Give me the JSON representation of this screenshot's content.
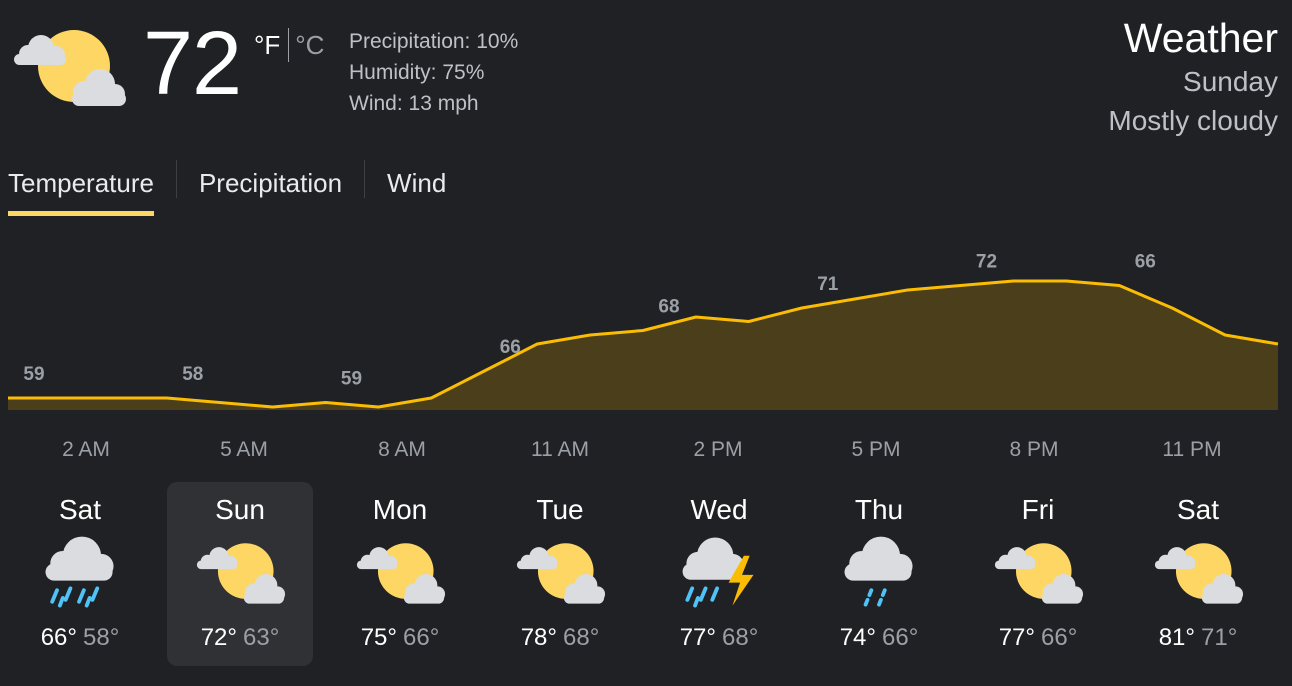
{
  "current": {
    "temperature": "72",
    "unit_f": "°F",
    "unit_c": "°C",
    "precipitation": "Precipitation: 10%",
    "humidity": "Humidity: 75%",
    "wind": "Wind: 13 mph",
    "icon": "partly-cloudy-icon"
  },
  "header": {
    "title": "Weather",
    "day": "Sunday",
    "condition": "Mostly cloudy"
  },
  "tabs": [
    {
      "label": "Temperature",
      "active": true
    },
    {
      "label": "Precipitation",
      "active": false
    },
    {
      "label": "Wind",
      "active": false
    }
  ],
  "colors": {
    "accent": "#fdd663",
    "chart_line": "#fbbc04",
    "chart_fill": "#4a3f1a",
    "background": "#202124",
    "selected_day": "#303134",
    "rain": "#4fc3f7"
  },
  "chart_data": {
    "type": "area",
    "x": [
      "12 AM",
      "1 AM",
      "2 AM",
      "3 AM",
      "4 AM",
      "5 AM",
      "6 AM",
      "7 AM",
      "8 AM",
      "9 AM",
      "10 AM",
      "11 AM",
      "12 PM",
      "1 PM",
      "2 PM",
      "3 PM",
      "4 PM",
      "5 PM",
      "6 PM",
      "7 PM",
      "8 PM",
      "9 PM",
      "10 PM",
      "11 PM",
      "12 AM"
    ],
    "values": [
      59,
      59,
      59,
      59,
      58.5,
      58,
      58.5,
      58,
      59,
      62,
      65,
      66,
      66.5,
      68,
      67.5,
      69,
      70,
      71,
      71.5,
      72,
      72,
      71.5,
      69,
      66,
      65
    ],
    "data_labels": [
      {
        "index": 0,
        "text": "59"
      },
      {
        "index": 3,
        "text": "58"
      },
      {
        "index": 6,
        "text": "59"
      },
      {
        "index": 9,
        "text": "66"
      },
      {
        "index": 12,
        "text": "68"
      },
      {
        "index": 15,
        "text": "71"
      },
      {
        "index": 18,
        "text": "72"
      },
      {
        "index": 21,
        "text": "66"
      }
    ],
    "x_tick_labels": [
      "2 AM",
      "5 AM",
      "8 AM",
      "11 AM",
      "2 PM",
      "5 PM",
      "8 PM",
      "11 PM"
    ],
    "ylim": [
      50,
      80
    ],
    "grid": false
  },
  "forecast": [
    {
      "day": "Sat",
      "icon": "rain-icon",
      "high": "66°",
      "low": "58°",
      "selected": false
    },
    {
      "day": "Sun",
      "icon": "partly-cloudy-icon",
      "high": "72°",
      "low": "63°",
      "selected": true
    },
    {
      "day": "Mon",
      "icon": "partly-cloudy-icon",
      "high": "75°",
      "low": "66°",
      "selected": false
    },
    {
      "day": "Tue",
      "icon": "partly-cloudy-icon",
      "high": "78°",
      "low": "68°",
      "selected": false
    },
    {
      "day": "Wed",
      "icon": "thunderstorm-icon",
      "high": "77°",
      "low": "68°",
      "selected": false
    },
    {
      "day": "Thu",
      "icon": "light-rain-icon",
      "high": "74°",
      "low": "66°",
      "selected": false
    },
    {
      "day": "Fri",
      "icon": "partly-cloudy-icon",
      "high": "77°",
      "low": "66°",
      "selected": false
    },
    {
      "day": "Sat",
      "icon": "partly-cloudy-icon",
      "high": "81°",
      "low": "71°",
      "selected": false
    }
  ]
}
